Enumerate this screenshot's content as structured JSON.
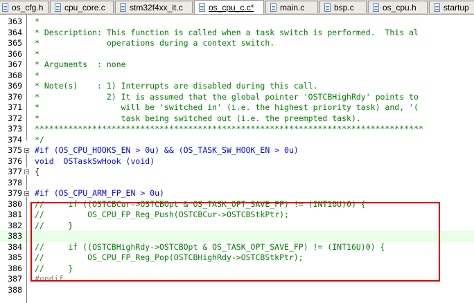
{
  "tabs": [
    {
      "label": "os_cfg.h",
      "active": false
    },
    {
      "label": "cpu_core.c",
      "active": false
    },
    {
      "label": "stm32f4xx_it.c",
      "active": false
    },
    {
      "label": "os_cpu_c.c*",
      "active": true
    },
    {
      "label": "main.c",
      "active": false
    },
    {
      "label": "bsp.c",
      "active": false
    },
    {
      "label": "os_cpu.h",
      "active": false
    },
    {
      "label": "startup",
      "active": false
    }
  ],
  "lines": [
    {
      "num": "363",
      "text": "*"
    },
    {
      "num": "364",
      "text": "* Description: This function is called when a task switch is performed.  This al"
    },
    {
      "num": "365",
      "text": "*              operations during a context switch."
    },
    {
      "num": "366",
      "text": "*"
    },
    {
      "num": "367",
      "text": "* Arguments  : none"
    },
    {
      "num": "368",
      "text": "*"
    },
    {
      "num": "369",
      "text": "* Note(s)    : 1) Interrupts are disabled during this call."
    },
    {
      "num": "370",
      "text": "*              2) It is assumed that the global pointer 'OSTCBHighRdy' points to"
    },
    {
      "num": "371",
      "text": "*                 will be 'switched in' (i.e. the highest priority task) and, '("
    },
    {
      "num": "372",
      "text": "*                 task being switched out (i.e. the preempted task)."
    },
    {
      "num": "373",
      "text": "*********************************************************************************"
    },
    {
      "num": "374",
      "text": "*/"
    },
    {
      "num": "375",
      "text": "#if (OS_CPU_HOOKS_EN > 0u) && (OS_TASK_SW_HOOK_EN > 0u)"
    },
    {
      "num": "376",
      "text": "void  OSTaskSwHook (void)"
    },
    {
      "num": "377",
      "text": "{"
    },
    {
      "num": "378",
      "text": ""
    },
    {
      "num": "379",
      "text": "#if (OS_CPU_ARM_FP_EN > 0u)"
    },
    {
      "num": "380",
      "text": "//     if ((OSTCBCur->OSTCBOpt & OS_TASK_OPT_SAVE_FP) != (INT16U)0) {"
    },
    {
      "num": "381",
      "text": "//         OS_CPU_FP_Reg_Push(OSTCBCur->OSTCBStkPtr);"
    },
    {
      "num": "382",
      "text": "//     }"
    },
    {
      "num": "383",
      "text": ""
    },
    {
      "num": "384",
      "text": "//     if ((OSTCBHighRdy->OSTCBOpt & OS_TASK_OPT_SAVE_FP) != (INT16U)0) {"
    },
    {
      "num": "385",
      "text": "//         OS_CPU_FP_Reg_Pop(OSTCBHighRdy->OSTCBStkPtr);"
    },
    {
      "num": "386",
      "text": "//     }"
    },
    {
      "num": "387",
      "text": "#endif"
    },
    {
      "num": "388",
      "text": ""
    }
  ]
}
